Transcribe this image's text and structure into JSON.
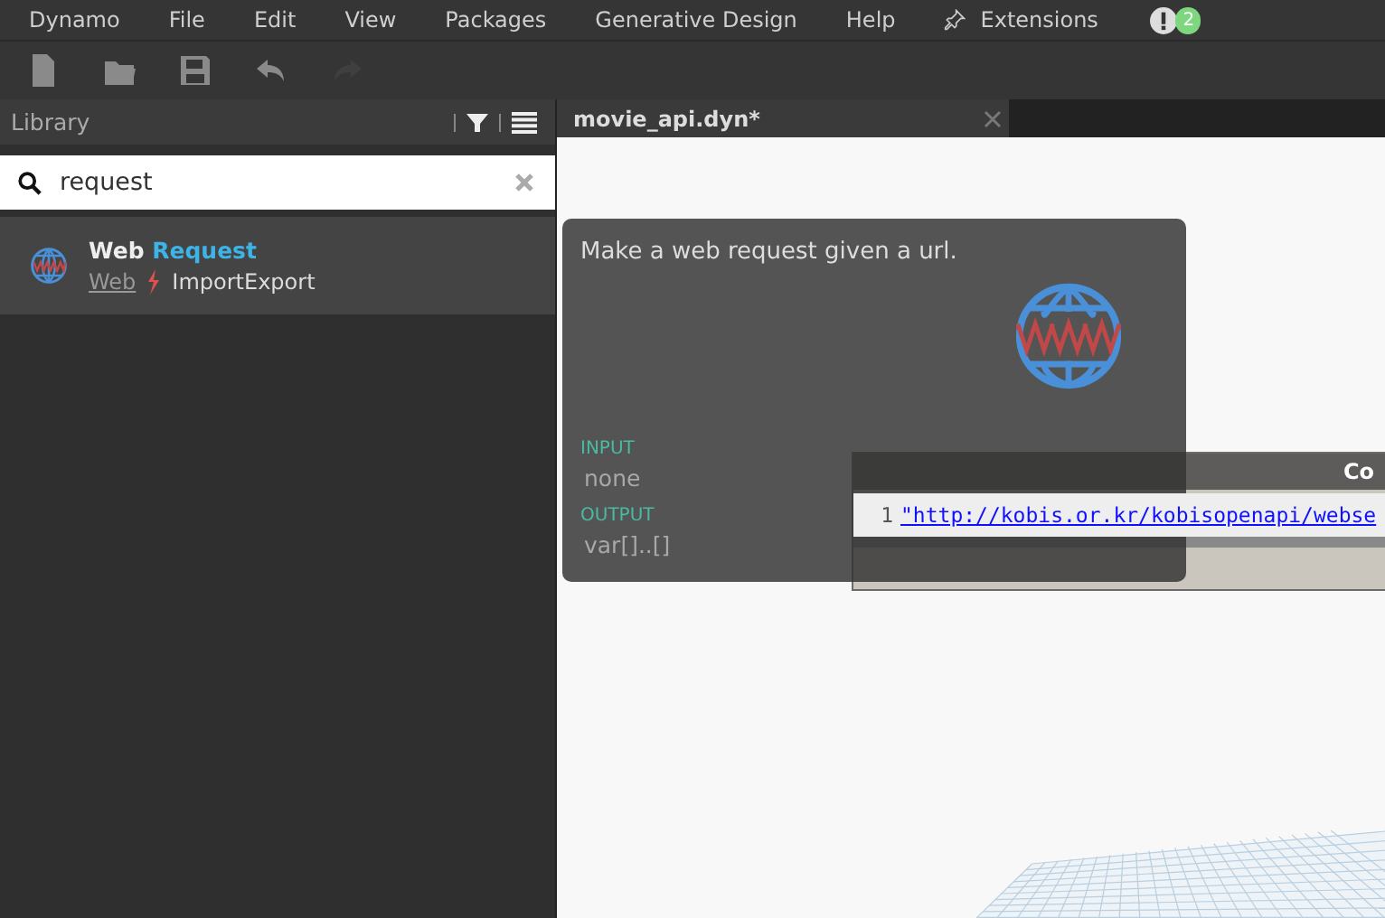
{
  "menu": [
    {
      "label": "Dynamo"
    },
    {
      "label": "File"
    },
    {
      "label": "Edit"
    },
    {
      "label": "View"
    },
    {
      "label": "Packages"
    },
    {
      "label": "Generative Design"
    },
    {
      "label": "Help"
    },
    {
      "label": "Extensions",
      "kind": "pinned"
    }
  ],
  "notifications": {
    "count": "2"
  },
  "toolbar": [
    {
      "kind": "new",
      "disabled": false
    },
    {
      "kind": "open",
      "disabled": false
    },
    {
      "kind": "save",
      "disabled": false
    },
    {
      "kind": "undo",
      "disabled": false
    },
    {
      "kind": "redo",
      "disabled": true
    }
  ],
  "library": {
    "title": "Library",
    "search": {
      "value": "request"
    },
    "results": [
      {
        "name_prefix": "Web ",
        "name_match": "Request",
        "category": "Web",
        "group": "ImportExport",
        "selected": true
      }
    ]
  },
  "tabs": [
    {
      "label": "movie_api.dyn*",
      "selected": true
    }
  ],
  "tooltip": {
    "description": "Make a web request given a url.",
    "input_label": "INPUT",
    "input": "none",
    "output_label": "OUTPUT",
    "output": "var[]..[]"
  },
  "code_node": {
    "title": "Co",
    "line_number": "1",
    "code": "\"http://kobis.or.kr/kobisopenapi/webse"
  }
}
